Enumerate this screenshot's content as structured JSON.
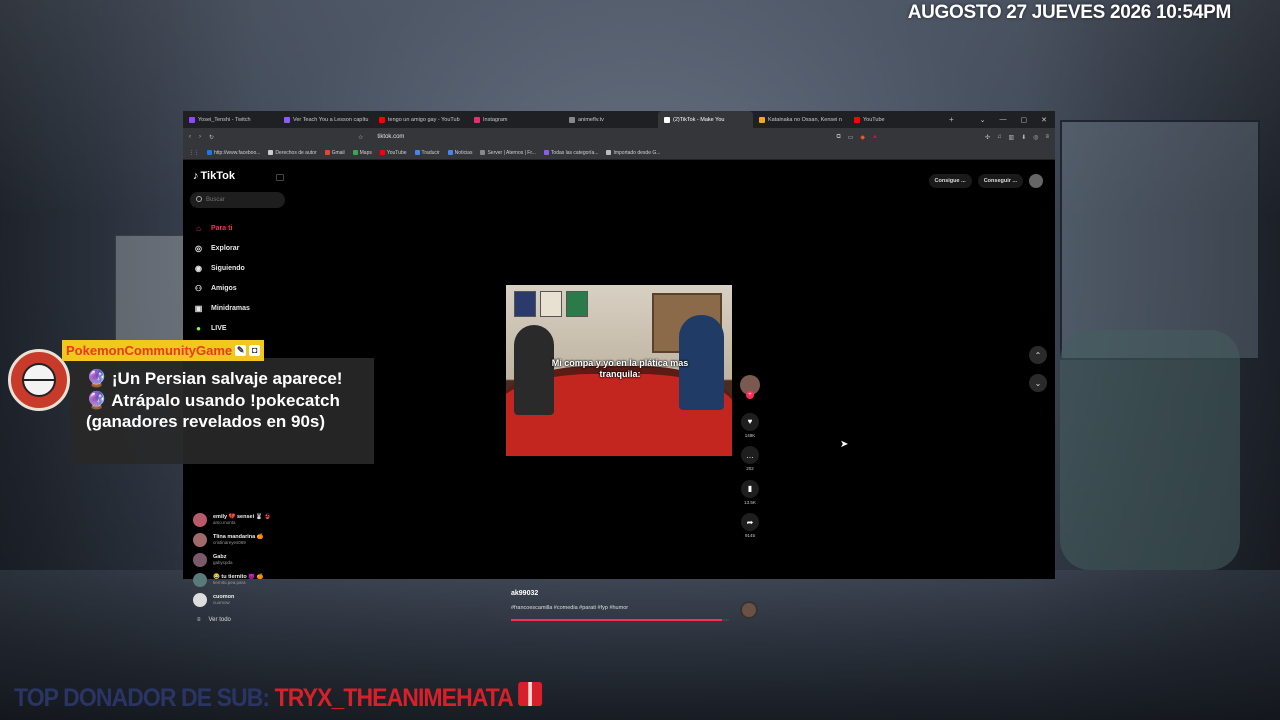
{
  "stream": {
    "datetime": "AUGOSTO 27 JUEVES 2026 10:54PM",
    "donor_label": "TOP DONADOR DE SUB:",
    "donor_name": "TRYX_THEANIMEHATA"
  },
  "browser": {
    "tabs": [
      {
        "label": "Yosei_Tenshi - Twitch",
        "color": "#9146ff"
      },
      {
        "label": "Ver Teach You a Lesson capítu",
        "color": "#8a5cf6"
      },
      {
        "label": "tengo un amigo gay - YouTub",
        "color": "#ff0000"
      },
      {
        "label": "Instagram",
        "color": "#e1306c"
      },
      {
        "label": "animeflv.tv",
        "color": "#888888"
      },
      {
        "label": "(2)TikTok - Make You",
        "color": "#ffffff"
      },
      {
        "label": "Katainaka no Ossan, Kensei n",
        "color": "#f5a623"
      },
      {
        "label": "YouTube",
        "color": "#ff0000"
      }
    ],
    "url": "tiktok.com",
    "bookmarks": [
      {
        "label": "http://www.faceboo...",
        "color": "#1877f2"
      },
      {
        "label": "Derechos de autor",
        "color": "#cccccc"
      },
      {
        "label": "Gmail",
        "color": "#ea4335"
      },
      {
        "label": "Maps",
        "color": "#34a853"
      },
      {
        "label": "YouTube",
        "color": "#ff0000"
      },
      {
        "label": "Traducir",
        "color": "#4285f4"
      },
      {
        "label": "Noticias",
        "color": "#4285f4"
      },
      {
        "label": "Server | Aternos | Fr...",
        "color": "#888888"
      },
      {
        "label": "Todas las categoría...",
        "color": "#8a5cf6"
      },
      {
        "label": "Importado desde G...",
        "color": "#bbbbbb"
      }
    ]
  },
  "tiktok": {
    "logo": "TikTok",
    "search_placeholder": "Buscar",
    "nav": [
      {
        "label": "Para ti",
        "icon": "home-icon"
      },
      {
        "label": "Explorar",
        "icon": "compass-icon"
      },
      {
        "label": "Siguiendo",
        "icon": "following-icon"
      },
      {
        "label": "Amigos",
        "icon": "friends-icon"
      },
      {
        "label": "Minidramas",
        "icon": "drama-icon"
      },
      {
        "label": "LIVE",
        "icon": "live-icon"
      }
    ],
    "following": [
      {
        "name": "emily 💔 sensei 🐰 👙",
        "handle": "amo.monta"
      },
      {
        "name": "Tlina mandarina 🍊",
        "handle": "cristinareyes069"
      },
      {
        "name": "Gabz",
        "handle": "gabycpda"
      },
      {
        "name": "😂 tu tiernito 😈 🍊",
        "handle": "tiernito.pea.para"
      },
      {
        "name": "cuomon",
        "handle": "cuomow"
      }
    ],
    "see_all": "Ver todo",
    "top_buttons": [
      "Consigue ...",
      "Conseguir ..."
    ],
    "video": {
      "caption": "Mi compa y yo en la plática mas tranquila:",
      "author": "ak99032",
      "tags": "#francoescamilla #comedia #parati #fyp #humor",
      "likes": "148K",
      "comments": "202",
      "saves": "13.5K",
      "shares": "9145",
      "progress": 0.97
    }
  },
  "chat": {
    "username": "PokemonCommunityGame",
    "message": "🔮 ¡Un Persian salvaje aparece! 🔮 Atrápalo usando !pokecatch (ganadores revelados en 90s)"
  }
}
